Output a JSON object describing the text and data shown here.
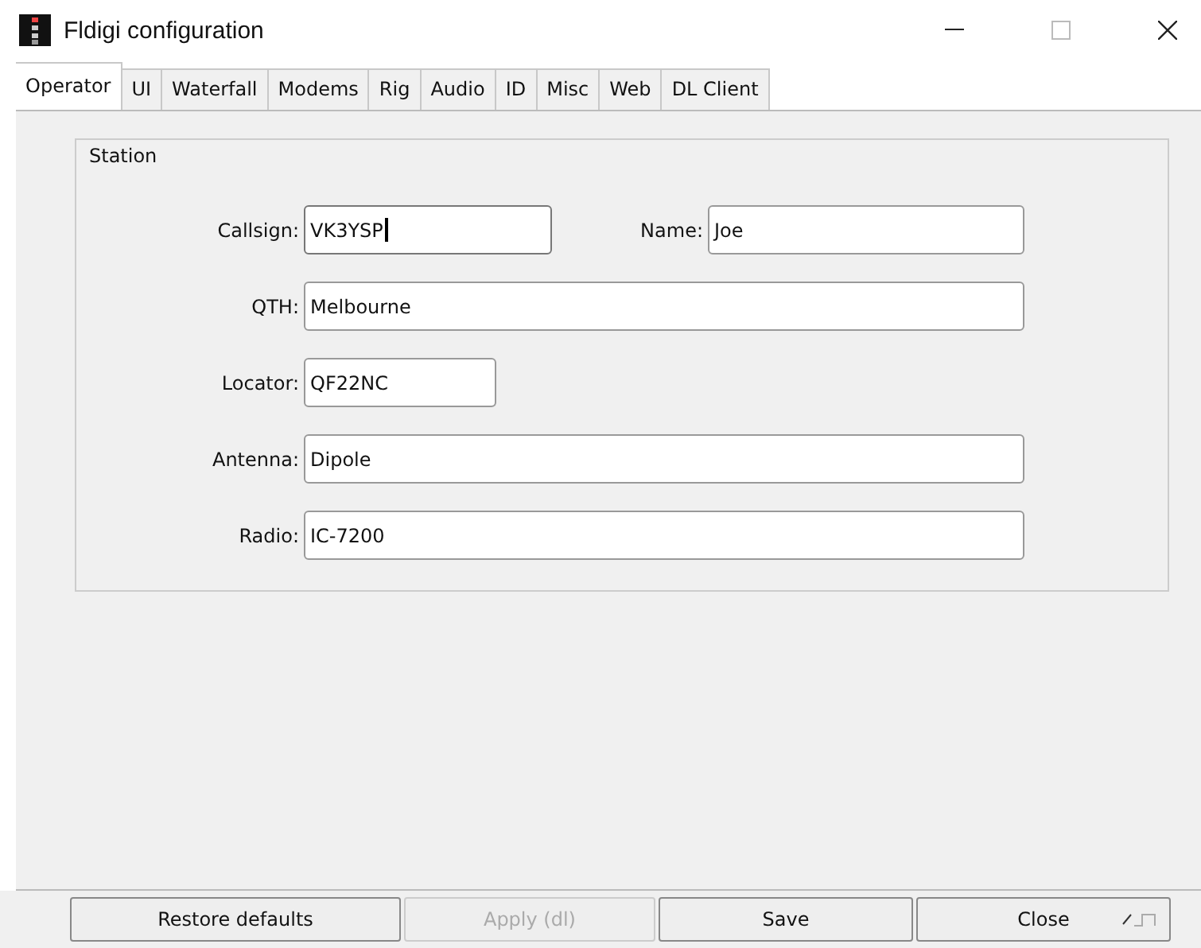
{
  "window": {
    "title": "Fldigi configuration"
  },
  "tabs": [
    {
      "label": "Operator",
      "selected": true
    },
    {
      "label": "UI",
      "selected": false
    },
    {
      "label": "Waterfall",
      "selected": false
    },
    {
      "label": "Modems",
      "selected": false
    },
    {
      "label": "Rig",
      "selected": false
    },
    {
      "label": "Audio",
      "selected": false
    },
    {
      "label": "ID",
      "selected": false
    },
    {
      "label": "Misc",
      "selected": false
    },
    {
      "label": "Web",
      "selected": false
    },
    {
      "label": "DL Client",
      "selected": false
    }
  ],
  "group": {
    "title": "Station",
    "rows": [
      [
        {
          "label": "Callsign:",
          "value": "VK3YSP",
          "focused": true
        },
        {
          "label": "Name:",
          "value": "Joe",
          "focused": false
        }
      ],
      [
        {
          "label": "QTH:",
          "value": "Melbourne",
          "focused": false
        }
      ],
      [
        {
          "label": "Locator:",
          "value": "QF22NC",
          "focused": false
        }
      ],
      [
        {
          "label": "Antenna:",
          "value": "Dipole",
          "focused": false
        }
      ],
      [
        {
          "label": "Radio:",
          "value": "IC-7200",
          "focused": false
        }
      ]
    ]
  },
  "buttons": [
    {
      "label": "Restore defaults",
      "disabled": false,
      "enter": false
    },
    {
      "label": "Apply (dl)",
      "disabled": true,
      "enter": false
    },
    {
      "label": "Save",
      "disabled": false,
      "enter": false
    },
    {
      "label": "Close",
      "disabled": false,
      "enter": true
    }
  ]
}
